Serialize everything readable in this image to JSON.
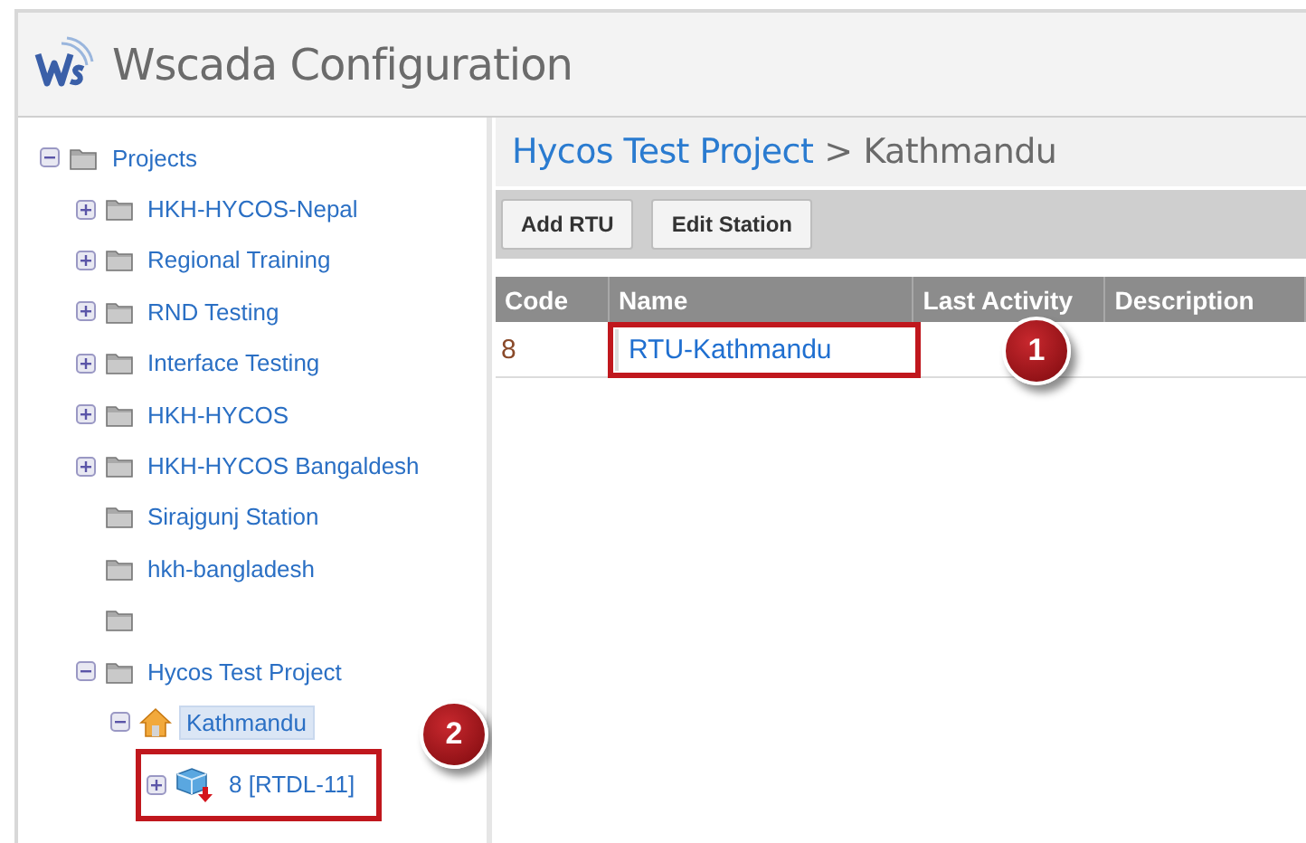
{
  "window": {
    "title": "Wscada Configuration"
  },
  "tree": [
    {
      "label": "Projects",
      "kind": "folder",
      "expanded": true,
      "selected": false,
      "highlighted": false,
      "children": [
        {
          "label": "HKH-HYCOS-Nepal",
          "kind": "folder",
          "expanded": false,
          "selected": false,
          "highlighted": false
        },
        {
          "label": "Regional Training",
          "kind": "folder",
          "expanded": false,
          "selected": false,
          "highlighted": false
        },
        {
          "label": "RND Testing",
          "kind": "folder",
          "expanded": false,
          "selected": false,
          "highlighted": false
        },
        {
          "label": "Interface Testing",
          "kind": "folder",
          "expanded": false,
          "selected": false,
          "highlighted": false
        },
        {
          "label": "HKH-HYCOS",
          "kind": "folder",
          "expanded": false,
          "selected": false,
          "highlighted": false
        },
        {
          "label": "HKH-HYCOS Bangaldesh",
          "kind": "folder",
          "expanded": false,
          "selected": false,
          "highlighted": false
        },
        {
          "label": "Sirajgunj Station",
          "kind": "folder",
          "selected": false,
          "highlighted": false
        },
        {
          "label": "hkh-bangladesh",
          "kind": "folder",
          "selected": false,
          "highlighted": false
        },
        {
          "kind": "folder",
          "highlighted": false
        },
        {
          "label": "Hycos Test Project",
          "kind": "folder",
          "expanded": true,
          "selected": false,
          "highlighted": false,
          "children": [
            {
              "label": "Kathmandu",
              "kind": "station",
              "expanded": true,
              "selected": true,
              "highlighted": false,
              "children": [
                {
                  "label": "8 [RTDL-11]",
                  "kind": "rtu",
                  "expanded": false,
                  "selected": false,
                  "highlighted": true,
                  "callout": "2"
                }
              ]
            }
          ]
        }
      ]
    }
  ],
  "breadcrumb": {
    "items": [
      {
        "label": "Hycos Test Project",
        "link": true
      },
      {
        "label": "Kathmandu",
        "link": false
      }
    ],
    "separator": ">"
  },
  "toolbar": {
    "buttons": [
      "Add RTU",
      "Edit Station"
    ]
  },
  "table": {
    "columns": [
      "Code",
      "Name",
      "Last Activity",
      "Description"
    ],
    "rows": [
      {
        "code": "8",
        "name": "RTU-Kathmandu",
        "highlighted": true,
        "callout": "1"
      }
    ]
  }
}
